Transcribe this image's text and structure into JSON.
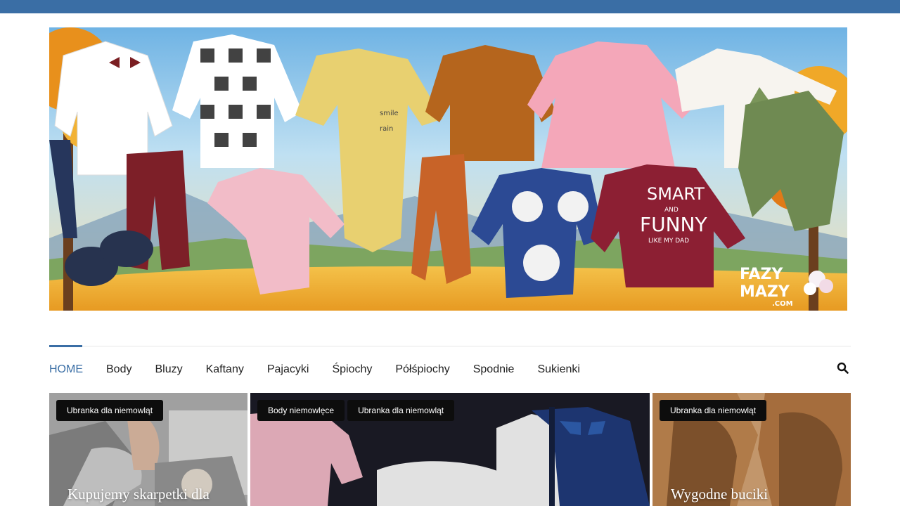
{
  "banner": {
    "logo_line1": "FAZY",
    "logo_line2": "MAZY",
    "logo_domain": ".COM",
    "onesie_text_line1": "SMART",
    "onesie_text_line2": "AND",
    "onesie_text_line3": "FUNNY",
    "onesie_text_line4": "LIKE MY DAD",
    "sleeper_text_line1": "smile",
    "sleeper_text_line2": "rain"
  },
  "nav": {
    "items": [
      {
        "label": "HOME",
        "active": true
      },
      {
        "label": "Body"
      },
      {
        "label": "Bluzy"
      },
      {
        "label": "Kaftany"
      },
      {
        "label": "Pajacyki"
      },
      {
        "label": "Śpiochy"
      },
      {
        "label": "Półśpiochy"
      },
      {
        "label": "Spodnie"
      },
      {
        "label": "Sukienki"
      }
    ],
    "search_icon": "search-icon"
  },
  "cards": [
    {
      "tags": [
        "Ubranka dla niemowląt"
      ],
      "title": "Kupujemy skarpetki dla"
    },
    {
      "tags": [
        "Body niemowlęce",
        "Ubranka dla niemowląt"
      ],
      "title": ""
    },
    {
      "tags": [
        "Ubranka dla niemowląt"
      ],
      "title": "Wygodne buciki"
    }
  ],
  "colors": {
    "topbar": "#3a6ea5",
    "accent": "#3a6ea5",
    "tag_bg": "#0d0d0d"
  }
}
